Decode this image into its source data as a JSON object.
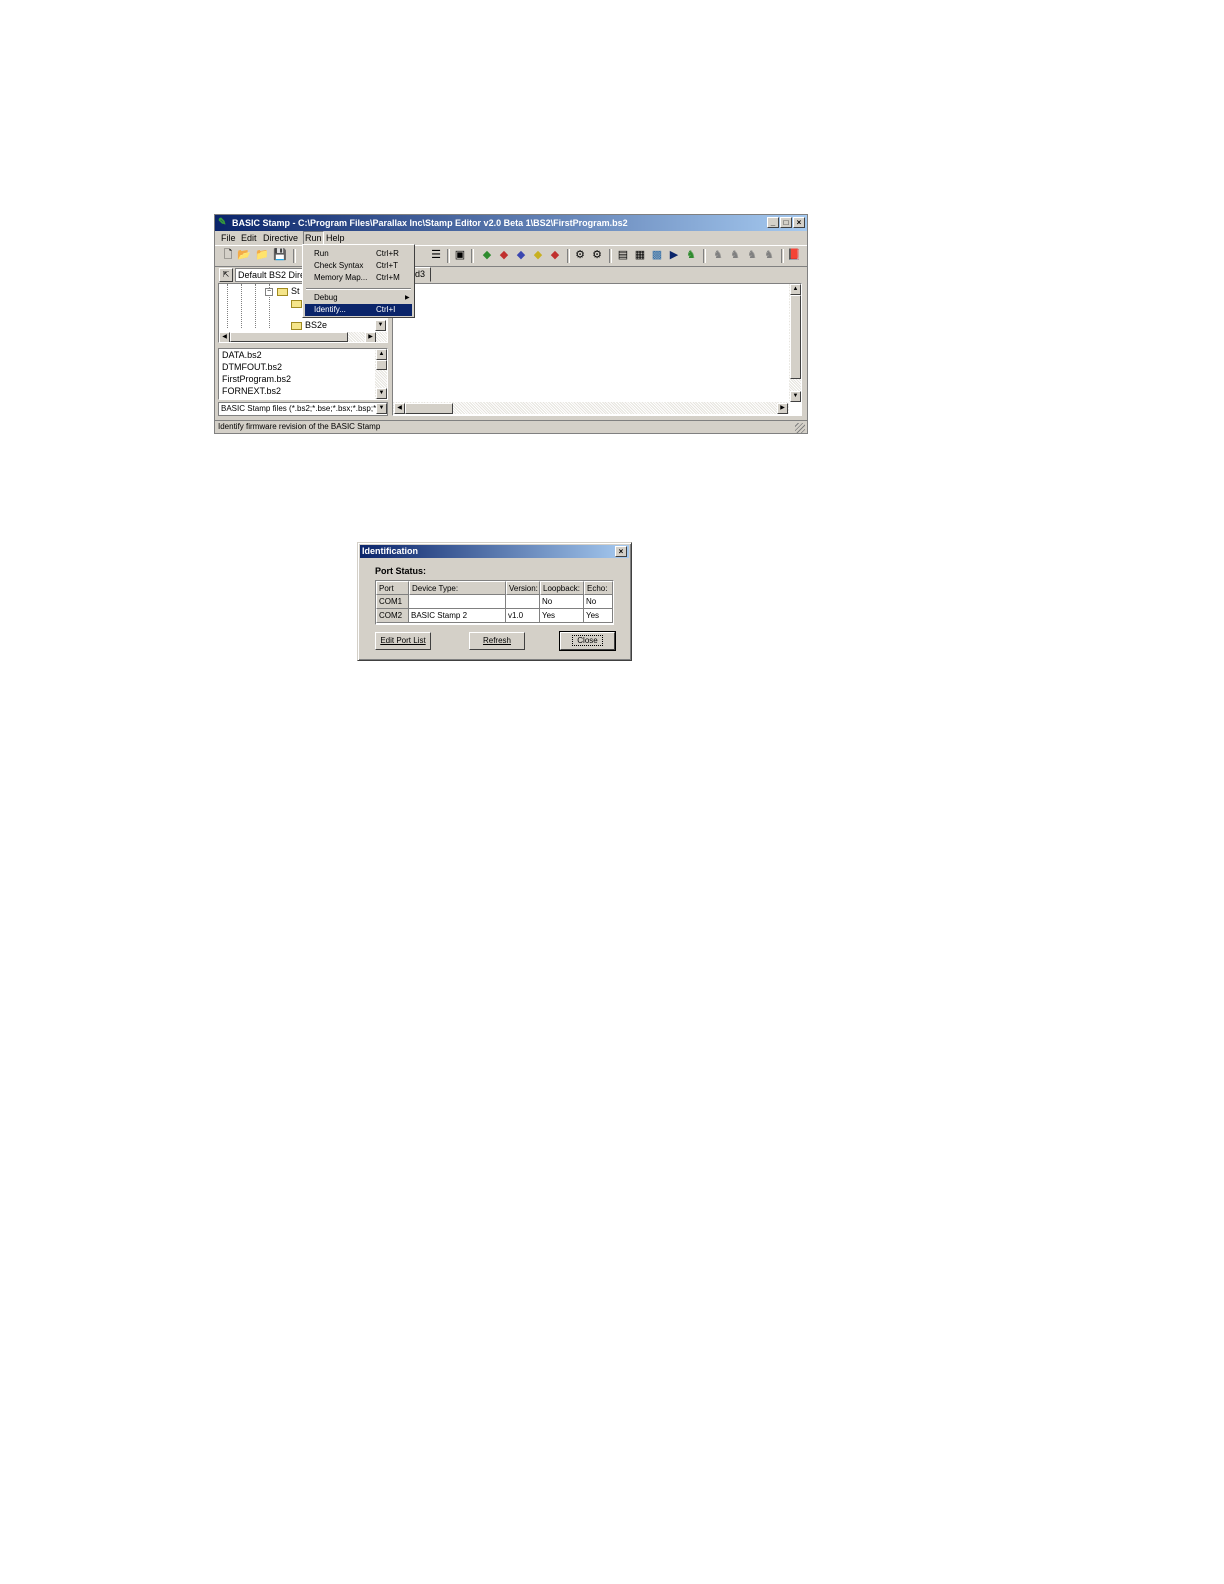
{
  "main_window": {
    "title": "BASIC Stamp - C:\\Program Files\\Parallax Inc\\Stamp Editor v2.0 Beta 1\\BS2\\FirstProgram.bs2",
    "menu": [
      "File",
      "Edit",
      "Directive",
      "Run",
      "Help"
    ],
    "run_menu": {
      "items": [
        {
          "label": "Run",
          "shortcut": "Ctrl+R"
        },
        {
          "label": "Check Syntax",
          "shortcut": "Ctrl+T"
        },
        {
          "label": "Memory Map...",
          "shortcut": "Ctrl+M"
        },
        {
          "label": "Debug",
          "shortcut": ""
        },
        {
          "label": "Identify...",
          "shortcut": "Ctrl+I"
        }
      ],
      "highlighted": "Identify..."
    },
    "directory_combo": "Default BS2 Direc",
    "editor_tab": "od3",
    "tree": {
      "folder_partial": "St",
      "folder_bs2e": "BS2e"
    },
    "files": [
      "DATA.bs2",
      "DTMFOUT.bs2",
      "FirstProgram.bs2",
      "FORNEXT.bs2"
    ],
    "file_filter": "BASIC Stamp files (*.bs2;*.bse;*.bsx;*.bsp;*",
    "status_text": "Identify firmware revision of the BASIC Stamp"
  },
  "dialog": {
    "title": "Identification",
    "section_label": "Port Status:",
    "columns": [
      "Port",
      "Device Type:",
      "Version:",
      "Loopback:",
      "Echo:"
    ],
    "rows": [
      [
        "COM1",
        "",
        "",
        "No",
        "No"
      ],
      [
        "COM2",
        "BASIC Stamp 2",
        "v1.0",
        "Yes",
        "Yes"
      ]
    ],
    "buttons": {
      "edit_port_list": "Edit Port List",
      "refresh": "Refresh",
      "close": "Close"
    }
  },
  "colors": {
    "title_active": "#0a246a",
    "title_gradient_end": "#a6caf0",
    "face": "#d4d0c8",
    "highlight": "#0a246a"
  }
}
